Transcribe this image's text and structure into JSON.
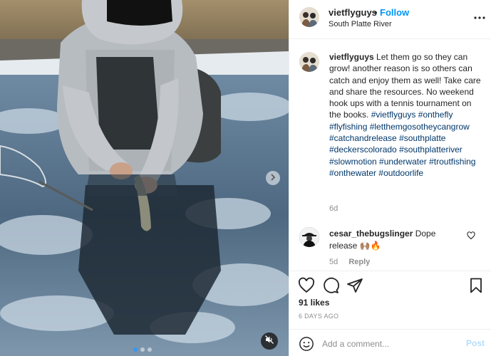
{
  "post": {
    "media": {
      "description_icon": "video-frame",
      "next_icon": "chevron-right-icon",
      "mute_icon": "speaker-muted-icon",
      "carousel_count": 3,
      "carousel_active_index": 0
    },
    "header": {
      "username": "vietflyguys",
      "separator": "•",
      "follow_label": "Follow",
      "location": "South Platte River",
      "more_icon": "more-horizontal-icon"
    },
    "caption": {
      "username": "vietflyguys",
      "text": "Let them go so they can grow! another reason is so others can catch and enjoy them as well! Take care and share the resources. No weekend hook ups with a tennis tournament on the books.",
      "hashtags": [
        "#vietflyguys",
        "#onthefly",
        "#flyfishing",
        "#letthemgosotheycangrow",
        "#catchandrelease",
        "#southplatte",
        "#deckerscolorado",
        "#southplatteriver",
        "#slowmotion",
        "#underwater",
        "#troutfishing",
        "#onthewater",
        "#outdoorlife"
      ],
      "time": "6d"
    },
    "comments": [
      {
        "username": "cesar_thebugslinger",
        "text": "Dope release 🙌🏽🔥",
        "time": "5d",
        "reply_label": "Reply"
      }
    ],
    "actions": {
      "like_icon": "heart-icon",
      "comment_icon": "comment-bubble-icon",
      "share_icon": "paper-plane-icon",
      "save_icon": "bookmark-icon",
      "likes": "91 likes",
      "date": "6 DAYS AGO"
    },
    "add_comment": {
      "placeholder": "Add a comment...",
      "post_label": "Post",
      "emoji_icon": "smiley-icon"
    }
  },
  "colors": {
    "link_blue": "#0095f6",
    "hashtag_blue": "#00376b",
    "muted_gray": "#8e8e8e",
    "post_disabled": "#b2dffc",
    "carousel_active": "#3897f0"
  }
}
